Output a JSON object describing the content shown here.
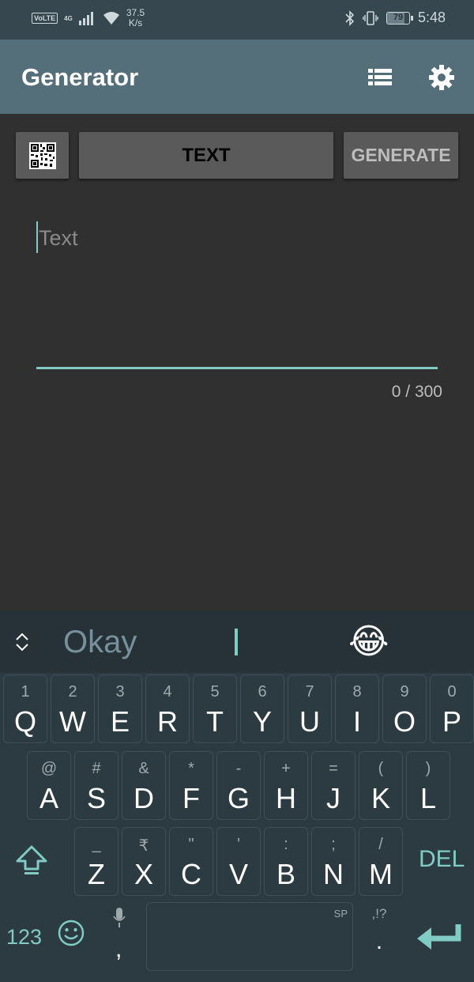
{
  "status_bar": {
    "volte": "VoLTE",
    "network": "4G",
    "speed_value": "37.5",
    "speed_unit": "K/s",
    "battery": "79",
    "time": "5:48"
  },
  "toolbar": {
    "title": "Generator"
  },
  "mode_row": {
    "text_label": "TEXT",
    "generate_label": "GENERATE"
  },
  "input": {
    "placeholder": "Text",
    "counter": "0 / 300"
  },
  "keyboard": {
    "suggestion": "Okay",
    "emoji_suggestion": "😂",
    "rows": [
      [
        {
          "sub": "1",
          "main": "Q"
        },
        {
          "sub": "2",
          "main": "W"
        },
        {
          "sub": "3",
          "main": "E"
        },
        {
          "sub": "4",
          "main": "R"
        },
        {
          "sub": "5",
          "main": "T"
        },
        {
          "sub": "6",
          "main": "Y"
        },
        {
          "sub": "7",
          "main": "U"
        },
        {
          "sub": "8",
          "main": "I"
        },
        {
          "sub": "9",
          "main": "O"
        },
        {
          "sub": "0",
          "main": "P"
        }
      ],
      [
        {
          "sub": "@",
          "main": "A"
        },
        {
          "sub": "#",
          "main": "S"
        },
        {
          "sub": "&",
          "main": "D"
        },
        {
          "sub": "*",
          "main": "F"
        },
        {
          "sub": "-",
          "main": "G"
        },
        {
          "sub": "+",
          "main": "H"
        },
        {
          "sub": "=",
          "main": "J"
        },
        {
          "sub": "(",
          "main": "K"
        },
        {
          "sub": ")",
          "main": "L"
        }
      ],
      [
        {
          "sub": "_",
          "main": "Z"
        },
        {
          "sub": "₹",
          "main": "X"
        },
        {
          "sub": "\"",
          "main": "C"
        },
        {
          "sub": "'",
          "main": "V"
        },
        {
          "sub": ":",
          "main": "B"
        },
        {
          "sub": ";",
          "main": "N"
        },
        {
          "sub": "/",
          "main": "M"
        }
      ]
    ],
    "del_label": "DEL",
    "num_label": "123",
    "comma": ",",
    "space_hint": "SP",
    "punct_hint": ",!?",
    "period": "."
  },
  "colors": {
    "accent": "#80cbc4",
    "toolbar": "#546e7a",
    "status_bar": "#37474f",
    "background": "#303030",
    "keyboard": "#263238"
  }
}
